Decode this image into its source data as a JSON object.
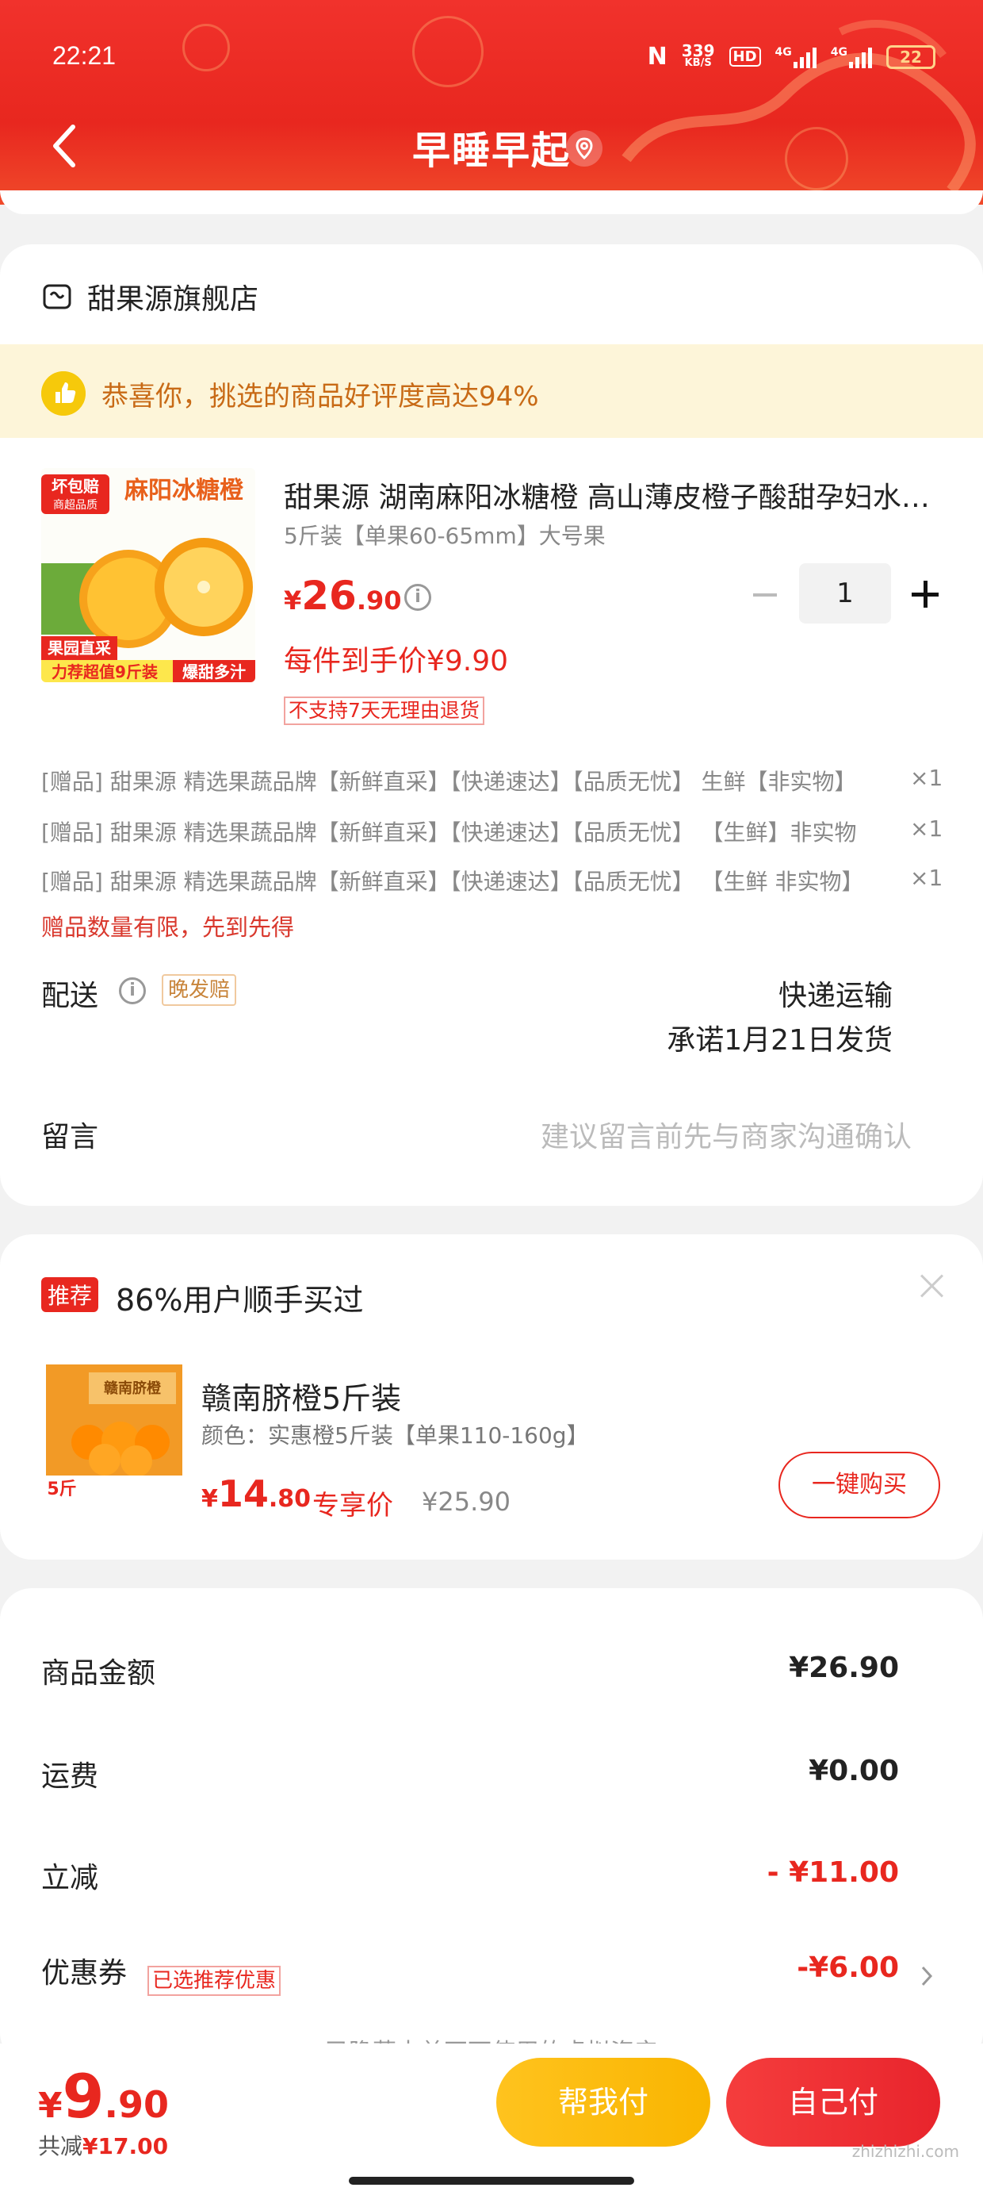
{
  "status_bar": {
    "time": "22:21",
    "nfc": "N",
    "speed_value": "339",
    "speed_unit": "KB/S",
    "hd": "HD",
    "net1": "4G",
    "net2": "4G",
    "battery": "22"
  },
  "header": {
    "title": "早睡早起"
  },
  "shop": {
    "name": "甜果源旗舰店",
    "banner_text": "恭喜你，挑选的商品好评度高达94%",
    "product": {
      "image_badge": "坏包赔",
      "image_badge2": "商超品质",
      "image_title": "麻阳冰糖橙",
      "image_tag1": "果园直采",
      "image_tag2": "力荐超值9斤装",
      "image_tag3": "爆甜多汁",
      "title": "甜果源 湖南麻阳冰糖橙 高山薄皮橙子酸甜孕妇水果新鲜",
      "spec": "5斤装【单果60-65mm】大号果",
      "price_symbol": "¥",
      "price_int": "26",
      "price_dec": ".90",
      "unit_price": "每件到手价¥9.90",
      "no_return": "不支持7天无理由退货",
      "quantity": "1"
    },
    "gifts": [
      {
        "text": "[赠品]  甜果源 精选果蔬品牌【新鲜直采】【快递速达】【品质无忧】 生鲜【非实物】",
        "count": "×1"
      },
      {
        "text": "[赠品]  甜果源 精选果蔬品牌【新鲜直采】【快递速达】【品质无忧】 【生鲜】非实物",
        "count": "×1"
      },
      {
        "text": "[赠品]  甜果源 精选果蔬品牌【新鲜直采】【快递速达】【品质无忧】 【生鲜 非实物】",
        "count": "×1"
      }
    ],
    "gift_note": "赠品数量有限，先到先得",
    "delivery": {
      "label": "配送",
      "tag": "晚发赔",
      "method": "快递运输",
      "promise": "承诺1月21日发货"
    },
    "memo": {
      "label": "留言",
      "placeholder": "建议留言前先与商家沟通确认"
    }
  },
  "recommend": {
    "tag": "推荐",
    "title": "86%用户顺手买过",
    "product": {
      "img_text1": "赣南脐橙",
      "img_text2": "5斤",
      "name": "赣南脐橙5斤装",
      "spec": "颜色：实惠橙5斤装【单果110-160g】",
      "price_symbol": "¥",
      "price_int": "14",
      "price_dec": ".80",
      "exclusive": "专享价",
      "original": "¥25.90",
      "buy_label": "一键购买"
    }
  },
  "summary": {
    "items_label": "商品金额",
    "items_value": "¥26.90",
    "shipping_label": "运费",
    "shipping_value": "¥0.00",
    "discount_label": "立减",
    "discount_value": "- ¥11.00",
    "coupon_label": "优惠券",
    "coupon_tag": "已选推荐优惠",
    "coupon_value": "-¥6.00",
    "hidden_note": "已隐藏本单不可使用的虚拟资产"
  },
  "bottom": {
    "total_symbol": "¥",
    "total_int": "9",
    "total_dec": ".90",
    "saved_label": "共减",
    "saved_value": "¥17.00",
    "help_pay": "帮我付",
    "self_pay": "自己付"
  },
  "watermark": "zhizhizhi.com",
  "colors": {
    "brand_red": "#e8271f",
    "help_yellow": "#ffc31e",
    "banner_bg": "#fdf5d9"
  }
}
